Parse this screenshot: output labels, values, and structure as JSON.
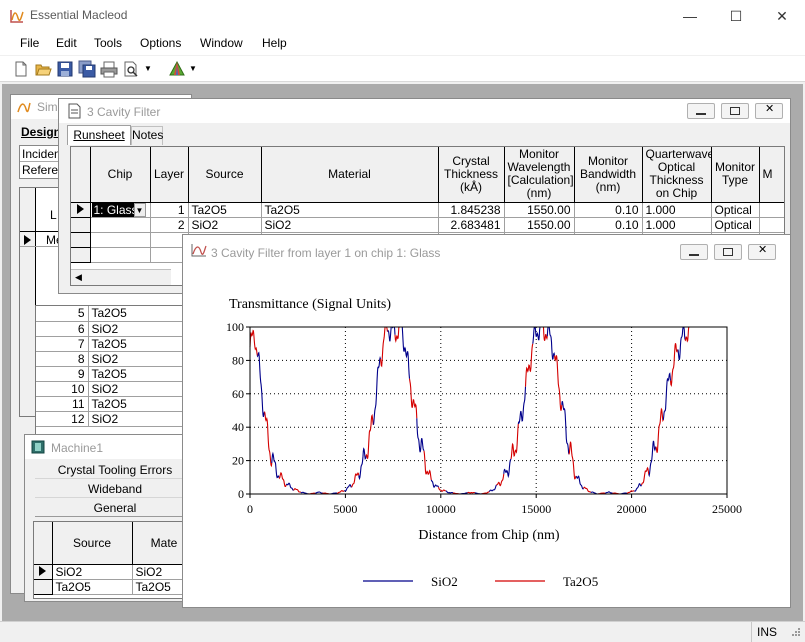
{
  "app": {
    "title": "Essential Macleod"
  },
  "menu": [
    "File",
    "Edit",
    "Tools",
    "Options",
    "Window",
    "Help"
  ],
  "toolbar": {
    "icons": [
      "new-file-icon",
      "open-folder-icon",
      "save-icon",
      "save-all-icon",
      "print-icon",
      "print-preview-icon",
      "plot-icon"
    ]
  },
  "status": {
    "mode": "INS"
  },
  "sim_window": {
    "title": "Sim",
    "tab": "Design",
    "fields": [
      "Inciden",
      "Referen"
    ],
    "col_header": "L",
    "row_marker": "Me",
    "rows": [
      {
        "n": "5",
        "m": "Ta2O5"
      },
      {
        "n": "6",
        "m": "SiO2"
      },
      {
        "n": "7",
        "m": "Ta2O5"
      },
      {
        "n": "8",
        "m": "SiO2"
      },
      {
        "n": "9",
        "m": "Ta2O5"
      },
      {
        "n": "10",
        "m": "SiO2"
      },
      {
        "n": "11",
        "m": "Ta2O5"
      },
      {
        "n": "12",
        "m": "SiO2"
      }
    ]
  },
  "cavity_window": {
    "title": "3 Cavity Filter",
    "tabs": [
      "Runsheet",
      "Notes"
    ],
    "headers": [
      "Chip",
      "Layer",
      "Source",
      "Material",
      "Crystal Thickness (kÅ)",
      "Monitor Wavelength [Calculation] (nm)",
      "Monitor Bandwidth (nm)",
      "Quarterwave Optical Thickness on Chip",
      "Monitor Type",
      "M"
    ],
    "rows": [
      {
        "chip": "1: Glass",
        "layer": "1",
        "source": "Ta2O5",
        "material": "Ta2O5",
        "thickness": "1.845238",
        "wavelength": "1550.00",
        "bandwidth": "0.10",
        "qwot": "1.000",
        "type": "Optical"
      },
      {
        "chip": "",
        "layer": "2",
        "source": "SiO2",
        "material": "SiO2",
        "thickness": "2.683481",
        "wavelength": "1550.00",
        "bandwidth": "0.10",
        "qwot": "1.000",
        "type": "Optical"
      }
    ]
  },
  "machine_window": {
    "title": "Machine1",
    "side_items": [
      "Crystal Tooling Errors",
      "Wideband",
      "General"
    ],
    "headers": [
      "Source",
      "Mate"
    ],
    "rows": [
      {
        "source": "SiO2",
        "mat": "SiO2"
      },
      {
        "source": "Ta2O5",
        "mat": "Ta2O5"
      }
    ]
  },
  "plot_window": {
    "title": "3 Cavity Filter from layer 1 on chip 1: Glass"
  },
  "chart_data": {
    "type": "line",
    "title": "Transmittance (Signal Units)",
    "xlabel": "Distance from Chip (nm)",
    "ylabel": "",
    "xlim": [
      0,
      25000
    ],
    "ylim": [
      0,
      100
    ],
    "x_ticks": [
      "0",
      "5000",
      "10000",
      "15000",
      "20000",
      "25000"
    ],
    "y_ticks": [
      "0",
      "20",
      "40",
      "60",
      "80",
      "100"
    ],
    "grid": true,
    "legend_position": "bottom",
    "series": [
      {
        "name": "SiO2",
        "color": "#00008b"
      },
      {
        "name": "Ta2O5",
        "color": "#d40000"
      }
    ],
    "envelope": {
      "x": [
        0,
        250,
        400,
        500,
        700,
        900,
        1100,
        1300,
        1600,
        1900,
        2300,
        2700,
        3100,
        3600,
        4200,
        4700,
        5100,
        5500,
        5900,
        6300,
        6600,
        6800,
        7000,
        7100,
        7300,
        7500,
        7700,
        7900,
        8100,
        8300,
        8600,
        8900,
        9200,
        9500,
        9900,
        10400,
        11000,
        11600,
        12100,
        12500,
        12900,
        13300,
        13700,
        14100,
        14400,
        14700,
        14900,
        15100,
        15300,
        15500,
        15700,
        15900,
        16100,
        16400,
        16700,
        17000,
        17300,
        17700,
        18200,
        18800,
        19400,
        19900,
        20300,
        20700,
        21100,
        21500,
        21800,
        22100,
        22400,
        22700,
        22900,
        23100
      ],
      "y": [
        88,
        96,
        84,
        72,
        54,
        36,
        24,
        16,
        10,
        6,
        3,
        1,
        0,
        1,
        0,
        1,
        3,
        8,
        18,
        34,
        58,
        78,
        92,
        98,
        100,
        96,
        98,
        100,
        92,
        74,
        52,
        32,
        18,
        8,
        3,
        1,
        0,
        1,
        0,
        1,
        4,
        10,
        20,
        38,
        60,
        82,
        94,
        100,
        97,
        99,
        94,
        88,
        72,
        50,
        30,
        14,
        6,
        2,
        0,
        1,
        0,
        1,
        3,
        10,
        22,
        40,
        58,
        74,
        86,
        94,
        98,
        100
      ]
    }
  }
}
